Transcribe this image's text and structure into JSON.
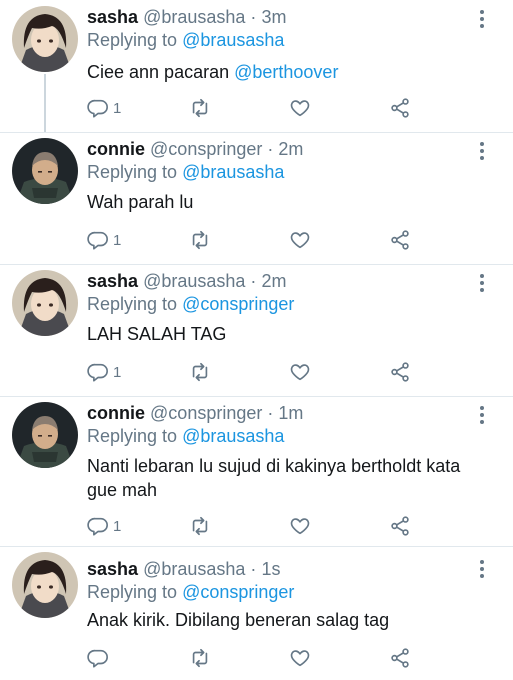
{
  "tweets": [
    {
      "name": "sasha",
      "handle": "@brausasha",
      "separator": "·",
      "time": "3m",
      "replying_prefix": "Replying to ",
      "replying_to": "@brausasha",
      "text_before": "Ciee ann pacaran ",
      "text_mention": "@berthoover",
      "text_after": "",
      "reply_count": "1",
      "avatar": "sasha-avatar"
    },
    {
      "name": "connie",
      "handle": "@conspringer",
      "separator": "·",
      "time": "2m",
      "replying_prefix": "Replying to ",
      "replying_to": "@brausasha",
      "text_before": "Wah parah lu",
      "text_mention": "",
      "text_after": "",
      "reply_count": "1",
      "avatar": "connie-avatar"
    },
    {
      "name": "sasha",
      "handle": "@brausasha",
      "separator": "·",
      "time": "2m",
      "replying_prefix": "Replying to ",
      "replying_to": "@conspringer",
      "text_before": "LAH SALAH TAG",
      "text_mention": "",
      "text_after": "",
      "reply_count": "1",
      "avatar": "sasha-avatar"
    },
    {
      "name": "connie",
      "handle": "@conspringer",
      "separator": "·",
      "time": "1m",
      "replying_prefix": "Replying to ",
      "replying_to": "@brausasha",
      "text_before": "Nanti lebaran lu sujud di kakinya bertholdt kata gue mah",
      "text_mention": "",
      "text_after": "",
      "reply_count": "1",
      "avatar": "connie-avatar"
    },
    {
      "name": "sasha",
      "handle": "@brausasha",
      "separator": "·",
      "time": "1s",
      "replying_prefix": "Replying to ",
      "replying_to": "@conspringer",
      "text_before": "Anak kirik. Dibilang beneran salag tag",
      "text_mention": "",
      "text_after": "",
      "reply_count": "",
      "avatar": "sasha-avatar"
    }
  ],
  "icons": {
    "reply": "reply-icon",
    "retweet": "retweet-icon",
    "like": "heart-icon",
    "share": "share-icon",
    "more": "more-vertical-icon"
  },
  "colors": {
    "link": "#1b95e0",
    "secondary_text": "#657786",
    "primary_text": "#14171a",
    "thread_line": "#ccd6dd"
  }
}
